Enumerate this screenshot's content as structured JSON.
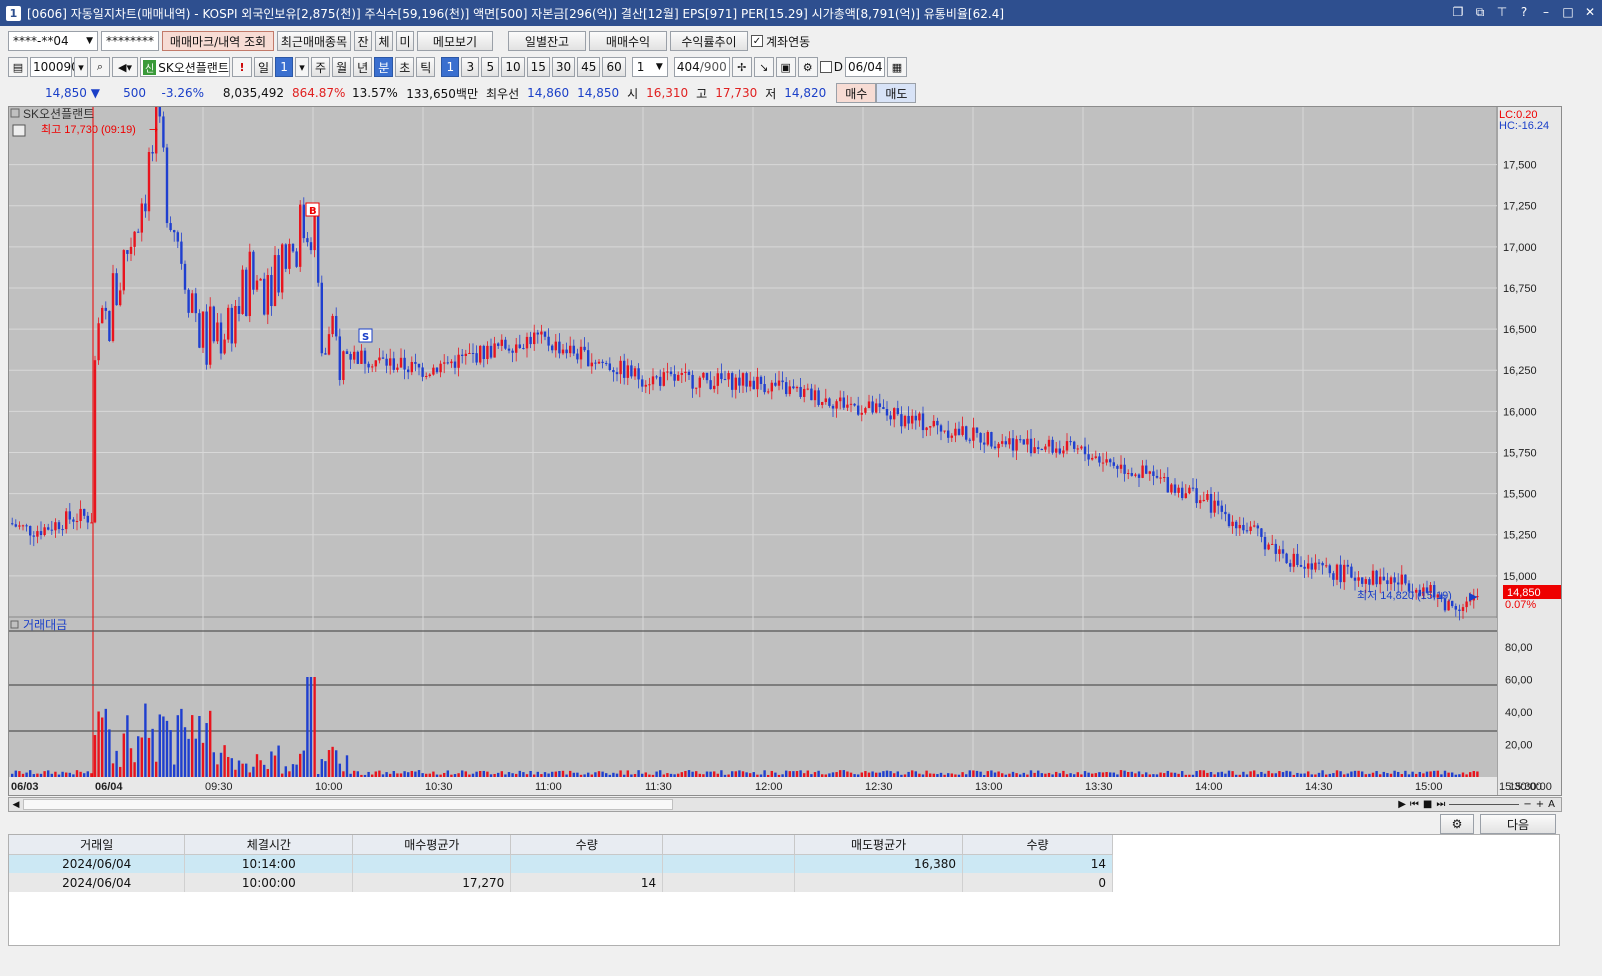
{
  "window": {
    "title": "[0606] 자동일지차트(매매내역) - KOSPI 외국인보유[2,875(천)] 주식수[59,196(천)] 액면[500] 자본금[296(억)] 결산[12월] EPS[971] PER[15.29] 시가총액[8,791(억)] 유통비율[62.4]",
    "app_icon": "1"
  },
  "toolbar1": {
    "account": "****-**04",
    "password": "********",
    "buttons": [
      "매매마크/내역 조회",
      "최근매매종목",
      "잔",
      "체",
      "미",
      "메모보기",
      "일별잔고",
      "매매수익",
      "수익률추이"
    ],
    "link_label": "계좌연동"
  },
  "toolbar2": {
    "code": "100090",
    "name": "SK오션플랜트",
    "new_badge": "신",
    "periods": [
      "일",
      "1",
      "주",
      "월",
      "년",
      "분",
      "초",
      "틱"
    ],
    "intervals": [
      "1",
      "3",
      "5",
      "10",
      "15",
      "30",
      "45",
      "60"
    ],
    "multiplier": "1",
    "count": "404",
    "count_total": "/900",
    "d_label": "D",
    "date": "06/04"
  },
  "quote": {
    "price": "14,850",
    "arrow": "▼",
    "change": "500",
    "rate": "-3.26%",
    "volume": "8,035,492",
    "vol_ratio": "864.87%",
    "turnover": "13.57%",
    "amount": "133,650백만",
    "best_label": "최우선",
    "ask": "14,860",
    "bid": "14,850",
    "open_label": "시",
    "open": "16,310",
    "high_label": "고",
    "high": "17,730",
    "low_label": "저",
    "low": "14,820",
    "buy_label": "매수",
    "sell_label": "매도"
  },
  "chart": {
    "name": "SK오션플랜트",
    "hi_label": "최고 17,730 (09:19)",
    "lo_label": "최저 14,820 (15:19)",
    "lc": "LC:0.20",
    "hc": "HC:-16.24",
    "last": "14,850",
    "pct": "0.07%",
    "vol_title": "거래대금",
    "yticks": [
      "17,500",
      "17,250",
      "17,000",
      "16,750",
      "16,500",
      "16,250",
      "16,000",
      "15,750",
      "15,500",
      "15,250",
      "15,000"
    ],
    "vticks": [
      "80,00",
      "60,00",
      "40,00",
      "20,00"
    ],
    "xticks": [
      "06/03",
      "06/04",
      "09:30",
      "10:00",
      "10:30",
      "11:00",
      "11:30",
      "12:00",
      "12:30",
      "13:00",
      "13:30",
      "14:00",
      "14:30",
      "15:00",
      "15:30:00"
    ],
    "marker_b": "B",
    "marker_s": "S",
    "colors": {
      "up": "#e8141e",
      "down": "#1f3fcf",
      "bg": "#c0c0c0"
    }
  },
  "chart_data": {
    "type": "candlestick",
    "ylim": [
      14750,
      17850
    ],
    "x": [
      "06/03 end",
      "09:00",
      "09:19",
      "09:30",
      "10:00",
      "10:14",
      "10:30",
      "11:00",
      "11:30",
      "12:00",
      "12:30",
      "13:00",
      "13:30",
      "14:00",
      "14:30",
      "15:00",
      "15:19",
      "15:30"
    ],
    "close": [
      15330,
      16250,
      17650,
      16400,
      17200,
      16380,
      16250,
      16450,
      16200,
      16180,
      16020,
      15850,
      15750,
      15500,
      15050,
      14950,
      14820,
      14850
    ],
    "high": 17730,
    "low": 14820
  },
  "bottom": {
    "next_label": "다음",
    "settings_icon": "gear-icon"
  },
  "table": {
    "headers": [
      "거래일",
      "체결시간",
      "매수평균가",
      "수량",
      "",
      "매도평균가",
      "수량"
    ],
    "rows": [
      [
        "2024/06/04",
        "10:14:00",
        "",
        "",
        "",
        "16,380",
        "14"
      ],
      [
        "2024/06/04",
        "10:00:00",
        "17,270",
        "14",
        "",
        "",
        "0"
      ]
    ]
  }
}
